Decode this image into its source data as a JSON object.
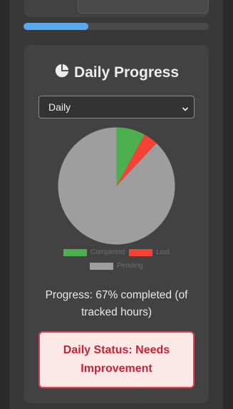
{
  "header": {
    "upper_progress": 0.35
  },
  "daily_card": {
    "title": "Daily Progress",
    "title_icon": "pie-chart-icon",
    "period_select": {
      "selected": "Daily"
    },
    "progress_text": "Progress: 67% completed (of tracked hours)",
    "status_text": "Daily Status: Needs Improvement"
  },
  "colors": {
    "completed": "#4caf50",
    "lost": "#f44336",
    "pending": "#9e9e9e",
    "accent_blue": "#5aa8f0",
    "status_red": "#c42535"
  },
  "chart_data": {
    "type": "pie",
    "categories": [
      "Completed",
      "Lost",
      "Pending"
    ],
    "values": [
      8,
      4,
      88
    ],
    "colors": [
      "#4caf50",
      "#f44336",
      "#9e9e9e"
    ],
    "legend_position": "bottom"
  }
}
